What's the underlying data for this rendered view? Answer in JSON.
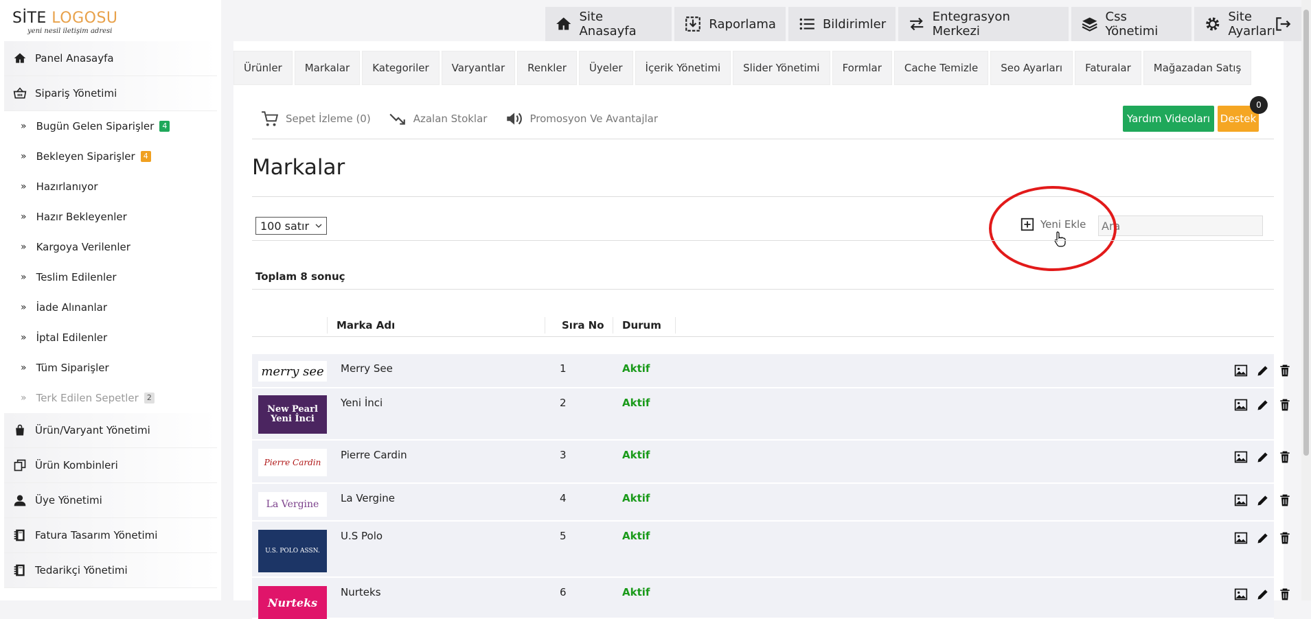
{
  "logo": {
    "line1_a": "SİTE ",
    "line1_b": "LOGOSU",
    "line2": "yeni nesil iletişim adresi"
  },
  "topnav": [
    {
      "label": "Site Anasayfa",
      "icon": "home-icon"
    },
    {
      "label": "Raporlama",
      "icon": "download-icon"
    },
    {
      "label": "Bildirimler",
      "icon": "list-icon"
    },
    {
      "label": "Entegrasyon Merkezi",
      "icon": "exchange-icon"
    },
    {
      "label": "Css Yönetimi",
      "icon": "layers-icon"
    },
    {
      "label": "Site Ayarları",
      "icon": "gear-icon"
    }
  ],
  "sidebar": {
    "items": [
      {
        "label": "Panel Anasayfa",
        "type": "main",
        "icon": "home-icon"
      },
      {
        "label": "Sipariş Yönetimi",
        "type": "main",
        "icon": "basket-icon"
      },
      {
        "label": "Bugün Gelen Siparişler",
        "type": "sub",
        "badge": "4",
        "badge_color": "green"
      },
      {
        "label": "Bekleyen Siparişler",
        "type": "sub",
        "badge": "4",
        "badge_color": "orange"
      },
      {
        "label": "Hazırlanıyor",
        "type": "sub"
      },
      {
        "label": "Hazır Bekleyenler",
        "type": "sub"
      },
      {
        "label": "Kargoya Verilenler",
        "type": "sub"
      },
      {
        "label": "Teslim Edilenler",
        "type": "sub"
      },
      {
        "label": "İade Alınanlar",
        "type": "sub"
      },
      {
        "label": "İptal Edilenler",
        "type": "sub"
      },
      {
        "label": "Tüm Siparişler",
        "type": "sub"
      },
      {
        "label": "Terk Edilen Sepetler",
        "type": "sub",
        "badge": "2",
        "badge_color": "gray",
        "muted": true
      },
      {
        "label": "Ürün/Varyant Yönetimi",
        "type": "main",
        "icon": "bag-icon"
      },
      {
        "label": "Ürün Kombinleri",
        "type": "main",
        "icon": "copy-icon"
      },
      {
        "label": "Üye Yönetimi",
        "type": "main",
        "icon": "user-icon"
      },
      {
        "label": "Fatura Tasarım Yönetimi",
        "type": "main",
        "icon": "notebook-icon"
      },
      {
        "label": "Tedarikçi Yönetimi",
        "type": "main",
        "icon": "notebook-icon"
      }
    ]
  },
  "tabs": [
    "Ürünler",
    "Markalar",
    "Kategoriler",
    "Varyantlar",
    "Renkler",
    "Üyeler",
    "İçerik Yönetimi",
    "Slider Yönetimi",
    "Formlar",
    "Cache Temizle",
    "Seo Ayarları",
    "Faturalar",
    "Mağazadan Satış"
  ],
  "tools": {
    "cart": "Sepet İzleme (0)",
    "stock": "Azalan Stoklar",
    "promo": "Promosyon Ve Avantajlar",
    "help": "Yardım Videoları",
    "support": "Destek",
    "support_count": "0"
  },
  "page": {
    "title": "Markalar",
    "rows_select": "100 satır",
    "add_new": "Yeni Ekle",
    "search_placeholder": "Ara",
    "total": "Toplam 8 sonuç"
  },
  "table": {
    "headers": {
      "name": "Marka Adı",
      "order": "Sıra No",
      "status": "Durum"
    },
    "rows": [
      {
        "logo_text": "merry see",
        "name": "Merry See",
        "order": "1",
        "status": "Aktif"
      },
      {
        "logo_text": "New Pearl Yeni İnci",
        "name": "Yeni İnci",
        "order": "2",
        "status": "Aktif"
      },
      {
        "logo_text": "Pierre Cardin",
        "name": "Pierre Cardin",
        "order": "3",
        "status": "Aktif"
      },
      {
        "logo_text": "La Vergine",
        "name": "La Vergine",
        "order": "4",
        "status": "Aktif"
      },
      {
        "logo_text": "U.S. POLO ASSN.",
        "name": "U.S Polo",
        "order": "5",
        "status": "Aktif"
      },
      {
        "logo_text": "Nurteks",
        "name": "Nurteks",
        "order": "6",
        "status": "Aktif"
      }
    ]
  }
}
